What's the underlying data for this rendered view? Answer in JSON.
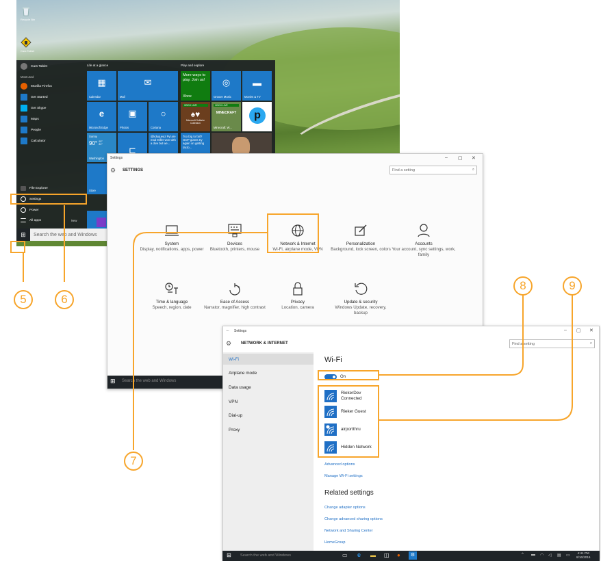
{
  "desktop": {
    "icons": [
      {
        "label": "Recycle Bin"
      },
      {
        "label": "Cars Tablet"
      }
    ]
  },
  "start_menu": {
    "user": "Cars Tablet",
    "most_used_header": "Most used",
    "apps": [
      {
        "label": "Mozilla Firefox",
        "has_arrow": true
      },
      {
        "label": "Get Started"
      },
      {
        "label": "Get Skype"
      },
      {
        "label": "Maps"
      },
      {
        "label": "People"
      },
      {
        "label": "Calculator"
      }
    ],
    "file_explorer": "File Explorer",
    "settings": "Settings",
    "power": "Power",
    "all_apps": "All apps",
    "new_badge": "New",
    "group1_header": "Life at a glance",
    "group2_header": "Play and explore",
    "tiles": {
      "calendar": "Calendar",
      "mail": "Mail",
      "edge": "Microsoft Edge",
      "photos": "Photos",
      "cortana": "Cortana",
      "weather_condition": "Sunny",
      "weather_temp": "90°",
      "weather_high": "93°",
      "weather_low": "81°",
      "weather_city": "Washington",
      "cortana_tweet": "@kduqueaz Pyl are mad Miller won with a dive but we...",
      "store": "Store",
      "xbox_promo": "More ways to play. Join us!",
      "xbox": "Xbox",
      "groove": "Groove Music",
      "movies": "Movies & TV",
      "xbox_live_1": "XBOX LIVE",
      "xbox_live_2": "XBOX LIVE",
      "solitaire": "Microsoft Solitaire Collection",
      "minecraft": "Minecraft: W...",
      "minecraft_logo": "MINECRAFT",
      "news_headline": "Too big to fail? GOP giants try again on getting tacto..."
    },
    "search_placeholder": "Search the web and Windows"
  },
  "settings_window": {
    "title": "Settings",
    "header": "SETTINGS",
    "search_placeholder": "Find a setting",
    "categories": [
      {
        "name": "System",
        "desc": "Display, notifications, apps, power",
        "icon": "laptop-icon"
      },
      {
        "name": "Devices",
        "desc": "Bluetooth, printers, mouse",
        "icon": "keyboard-icon"
      },
      {
        "name": "Network & Internet",
        "desc": "Wi-Fi, airplane mode, VPN",
        "icon": "globe-icon"
      },
      {
        "name": "Personalization",
        "desc": "Background, lock screen, colors",
        "icon": "paint-icon"
      },
      {
        "name": "Accounts",
        "desc": "Your account, sync settings, work, family",
        "icon": "person-icon"
      },
      {
        "name": "Time & language",
        "desc": "Speech, region, date",
        "icon": "time-language-icon"
      },
      {
        "name": "Ease of Access",
        "desc": "Narrator, magnifier, high contrast",
        "icon": "ease-icon"
      },
      {
        "name": "Privacy",
        "desc": "Location, camera",
        "icon": "lock-icon"
      },
      {
        "name": "Update & security",
        "desc": "Windows Update, recovery, backup",
        "icon": "update-icon"
      }
    ],
    "taskbar_search": "Search the web and Windows"
  },
  "network_window": {
    "title": "Settings",
    "header": "NETWORK & INTERNET",
    "search_placeholder": "Find a setting",
    "nav": [
      "Wi-Fi",
      "Airplane mode",
      "Data usage",
      "VPN",
      "Dial-up",
      "Proxy"
    ],
    "nav_selected": 0,
    "section_title": "Wi-Fi",
    "toggle_label": "On",
    "toggle_on": true,
    "networks": [
      {
        "name": "RiekerDev",
        "status": "Connected"
      },
      {
        "name": "Rieker Guest",
        "status": ""
      },
      {
        "name": "airportthru",
        "status": ""
      },
      {
        "name": "Hidden Network",
        "status": ""
      }
    ],
    "advanced_options": "Advanced options",
    "manage_wifi": "Manage Wi-Fi settings",
    "related_title": "Related settings",
    "related_links": [
      "Change adapter options",
      "Change advanced sharing options",
      "Network and Sharing Center",
      "HomeGroup"
    ],
    "taskbar_search": "Search the web and Windows",
    "time": "4:41 PM",
    "date": "8/16/2016"
  },
  "callouts": [
    "5",
    "6",
    "7",
    "8",
    "9"
  ],
  "colors": {
    "accent": "#1f6fc5",
    "callout": "#f7a52b",
    "tile_blue": "#1e79c8",
    "tile_green": "#107c10",
    "taskbar": "#1f2428"
  }
}
